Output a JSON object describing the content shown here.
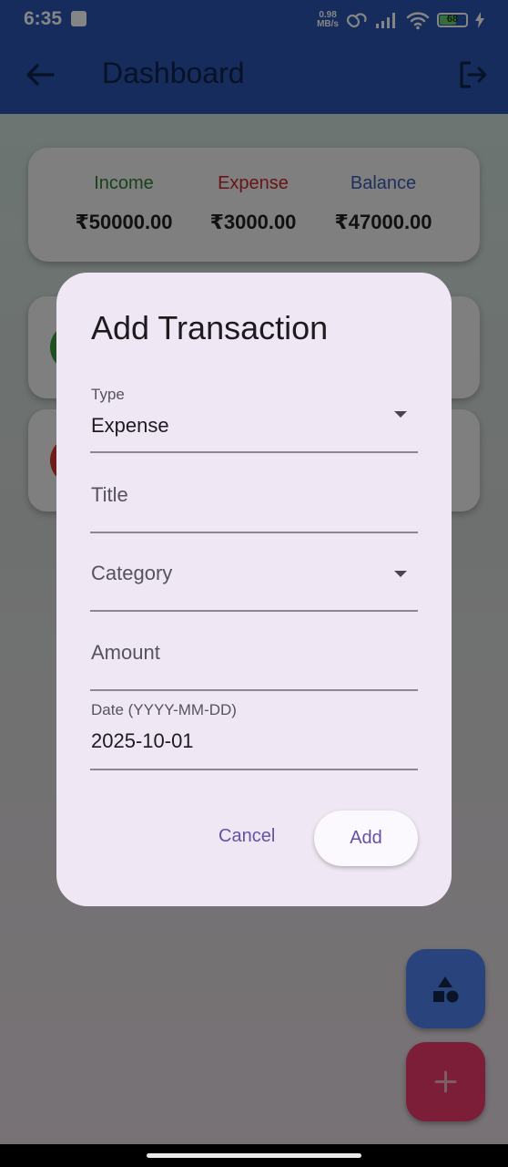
{
  "status_bar": {
    "time": "6:35",
    "speed_value": "0.98",
    "speed_unit": "MB/s",
    "battery": "68"
  },
  "app_bar": {
    "title": "Dashboard"
  },
  "summary": {
    "income_label": "Income",
    "income_value": "₹50000.00",
    "expense_label": "Expense",
    "expense_value": "₹3000.00",
    "balance_label": "Balance",
    "balance_value": "₹47000.00"
  },
  "colors": {
    "income": "#2f7d32",
    "expense": "#c62828",
    "balance": "#3d5ab4",
    "accent": "#6750a4"
  },
  "dialog": {
    "title": "Add Transaction",
    "type": {
      "label": "Type",
      "value": "Expense"
    },
    "title_field": {
      "placeholder": "Title"
    },
    "category": {
      "placeholder": "Category"
    },
    "amount": {
      "placeholder": "Amount"
    },
    "date": {
      "label": "Date (YYYY-MM-DD)",
      "value": "2025-10-01"
    },
    "cancel_label": "Cancel",
    "add_label": "Add"
  },
  "fabs": {
    "categories_icon": "shapes-icon",
    "add_icon": "plus-icon"
  }
}
